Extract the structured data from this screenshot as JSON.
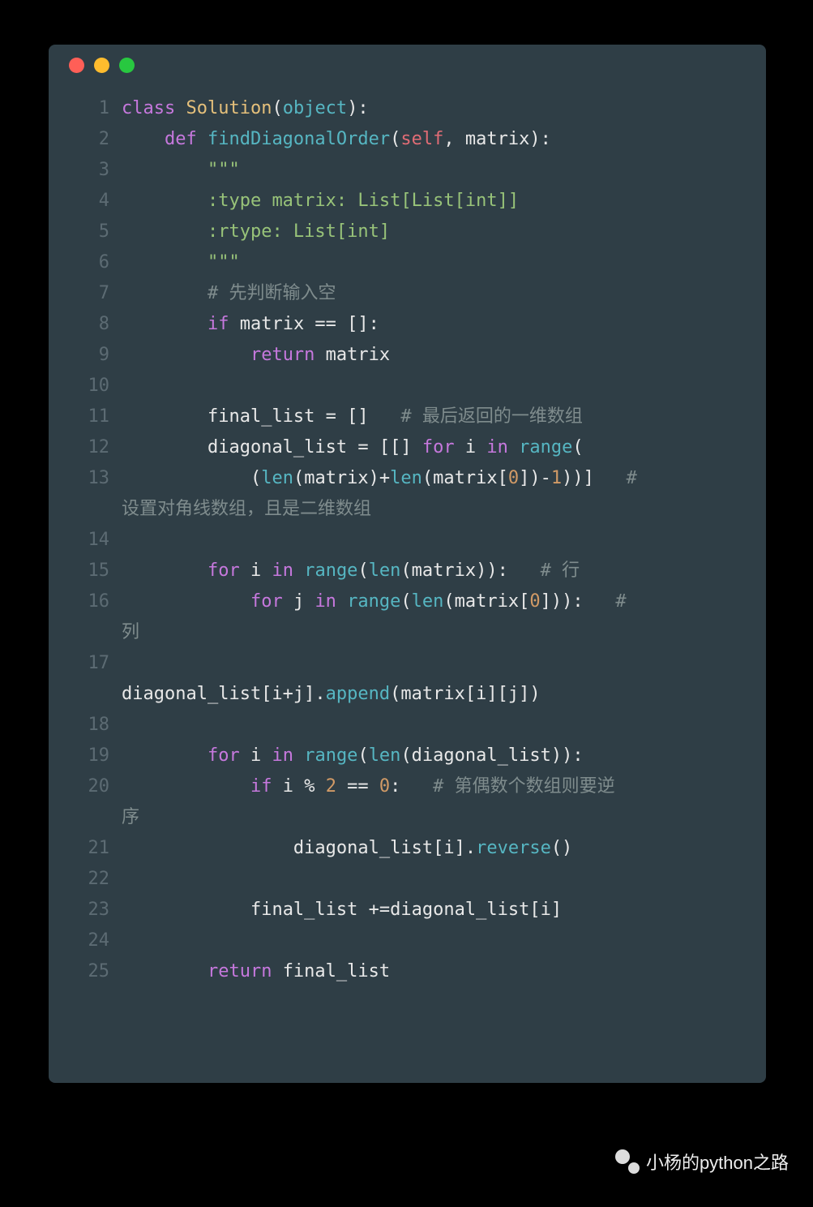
{
  "window": {
    "dots": [
      "red",
      "yellow",
      "green"
    ]
  },
  "code": {
    "lines": [
      {
        "n": 1,
        "tokens": [
          {
            "t": "class ",
            "c": "kw"
          },
          {
            "t": "Solution",
            "c": "cls"
          },
          {
            "t": "(",
            "c": "punct"
          },
          {
            "t": "object",
            "c": "builtin"
          },
          {
            "t": "):",
            "c": "punct"
          }
        ]
      },
      {
        "n": 2,
        "tokens": [
          {
            "t": "    ",
            "c": ""
          },
          {
            "t": "def ",
            "c": "kw"
          },
          {
            "t": "findDiagonalOrder",
            "c": "fn"
          },
          {
            "t": "(",
            "c": "punct"
          },
          {
            "t": "self",
            "c": "self"
          },
          {
            "t": ", matrix):",
            "c": "param"
          }
        ]
      },
      {
        "n": 3,
        "tokens": [
          {
            "t": "        ",
            "c": ""
          },
          {
            "t": "\"\"\"",
            "c": "str"
          }
        ]
      },
      {
        "n": 4,
        "tokens": [
          {
            "t": "        ",
            "c": ""
          },
          {
            "t": ":type matrix: List[List[int]]",
            "c": "str"
          }
        ]
      },
      {
        "n": 5,
        "tokens": [
          {
            "t": "        ",
            "c": ""
          },
          {
            "t": ":rtype: List[int]",
            "c": "str"
          }
        ]
      },
      {
        "n": 6,
        "tokens": [
          {
            "t": "        ",
            "c": ""
          },
          {
            "t": "\"\"\"",
            "c": "str"
          }
        ]
      },
      {
        "n": 7,
        "tokens": [
          {
            "t": "        ",
            "c": ""
          },
          {
            "t": "# 先判断输入空",
            "c": "comment"
          }
        ]
      },
      {
        "n": 8,
        "tokens": [
          {
            "t": "        ",
            "c": ""
          },
          {
            "t": "if ",
            "c": "kw"
          },
          {
            "t": "matrix == []:",
            "c": "op"
          }
        ]
      },
      {
        "n": 9,
        "tokens": [
          {
            "t": "            ",
            "c": ""
          },
          {
            "t": "return ",
            "c": "kw"
          },
          {
            "t": "matrix",
            "c": "op"
          }
        ]
      },
      {
        "n": 10,
        "tokens": [
          {
            "t": "",
            "c": ""
          }
        ]
      },
      {
        "n": 11,
        "tokens": [
          {
            "t": "        ",
            "c": ""
          },
          {
            "t": "final_list = []   ",
            "c": "op"
          },
          {
            "t": "# 最后返回的一维数组",
            "c": "comment"
          }
        ]
      },
      {
        "n": 12,
        "tokens": [
          {
            "t": "        ",
            "c": ""
          },
          {
            "t": "diagonal_list = [[] ",
            "c": "op"
          },
          {
            "t": "for ",
            "c": "kw"
          },
          {
            "t": "i ",
            "c": "op"
          },
          {
            "t": "in ",
            "c": "kw"
          },
          {
            "t": "range",
            "c": "builtin"
          },
          {
            "t": "(",
            "c": "punct"
          }
        ]
      },
      {
        "n": 13,
        "tokens": [
          {
            "t": "            ",
            "c": ""
          },
          {
            "t": "(",
            "c": "punct"
          },
          {
            "t": "len",
            "c": "builtin"
          },
          {
            "t": "(matrix)+",
            "c": "op"
          },
          {
            "t": "len",
            "c": "builtin"
          },
          {
            "t": "(matrix[",
            "c": "op"
          },
          {
            "t": "0",
            "c": "num"
          },
          {
            "t": "])-",
            "c": "op"
          },
          {
            "t": "1",
            "c": "num"
          },
          {
            "t": "))]   ",
            "c": "op"
          },
          {
            "t": "# ",
            "c": "comment"
          }
        ],
        "wrap": "设置对角线数组，且是二维数组"
      },
      {
        "n": 14,
        "tokens": [
          {
            "t": "",
            "c": ""
          }
        ]
      },
      {
        "n": 15,
        "tokens": [
          {
            "t": "        ",
            "c": ""
          },
          {
            "t": "for ",
            "c": "kw"
          },
          {
            "t": "i ",
            "c": "op"
          },
          {
            "t": "in ",
            "c": "kw"
          },
          {
            "t": "range",
            "c": "builtin"
          },
          {
            "t": "(",
            "c": "punct"
          },
          {
            "t": "len",
            "c": "builtin"
          },
          {
            "t": "(matrix)):   ",
            "c": "op"
          },
          {
            "t": "# 行",
            "c": "comment"
          }
        ]
      },
      {
        "n": 16,
        "tokens": [
          {
            "t": "            ",
            "c": ""
          },
          {
            "t": "for ",
            "c": "kw"
          },
          {
            "t": "j ",
            "c": "op"
          },
          {
            "t": "in ",
            "c": "kw"
          },
          {
            "t": "range",
            "c": "builtin"
          },
          {
            "t": "(",
            "c": "punct"
          },
          {
            "t": "len",
            "c": "builtin"
          },
          {
            "t": "(matrix[",
            "c": "op"
          },
          {
            "t": "0",
            "c": "num"
          },
          {
            "t": "])):   ",
            "c": "op"
          },
          {
            "t": "# ",
            "c": "comment"
          }
        ],
        "wrap": "列"
      },
      {
        "n": 17,
        "tokens": [
          {
            "t": "                ",
            "c": ""
          }
        ],
        "wrap2": [
          {
            "t": "diagonal_list[i+j].",
            "c": "op"
          },
          {
            "t": "append",
            "c": "method"
          },
          {
            "t": "(matrix[i][j])",
            "c": "op"
          }
        ]
      },
      {
        "n": 18,
        "tokens": [
          {
            "t": "",
            "c": ""
          }
        ]
      },
      {
        "n": 19,
        "tokens": [
          {
            "t": "        ",
            "c": ""
          },
          {
            "t": "for ",
            "c": "kw"
          },
          {
            "t": "i ",
            "c": "op"
          },
          {
            "t": "in ",
            "c": "kw"
          },
          {
            "t": "range",
            "c": "builtin"
          },
          {
            "t": "(",
            "c": "punct"
          },
          {
            "t": "len",
            "c": "builtin"
          },
          {
            "t": "(diagonal_list)):",
            "c": "op"
          }
        ]
      },
      {
        "n": 20,
        "tokens": [
          {
            "t": "            ",
            "c": ""
          },
          {
            "t": "if ",
            "c": "kw"
          },
          {
            "t": "i % ",
            "c": "op"
          },
          {
            "t": "2",
            "c": "num"
          },
          {
            "t": " == ",
            "c": "op"
          },
          {
            "t": "0",
            "c": "num"
          },
          {
            "t": ":   ",
            "c": "op"
          },
          {
            "t": "# 第偶数个数组则要逆",
            "c": "comment"
          }
        ],
        "wrap": "序"
      },
      {
        "n": 21,
        "tokens": [
          {
            "t": "                ",
            "c": ""
          },
          {
            "t": "diagonal_list[i].",
            "c": "op"
          },
          {
            "t": "reverse",
            "c": "method"
          },
          {
            "t": "()",
            "c": "op"
          }
        ]
      },
      {
        "n": 22,
        "tokens": [
          {
            "t": "",
            "c": ""
          }
        ]
      },
      {
        "n": 23,
        "tokens": [
          {
            "t": "            ",
            "c": ""
          },
          {
            "t": "final_list +=diagonal_list[i]",
            "c": "op"
          }
        ]
      },
      {
        "n": 24,
        "tokens": [
          {
            "t": "",
            "c": ""
          }
        ]
      },
      {
        "n": 25,
        "tokens": [
          {
            "t": "        ",
            "c": ""
          },
          {
            "t": "return ",
            "c": "kw"
          },
          {
            "t": "final_list",
            "c": "op"
          }
        ]
      }
    ]
  },
  "watermark": {
    "text": "小杨的python之路"
  }
}
